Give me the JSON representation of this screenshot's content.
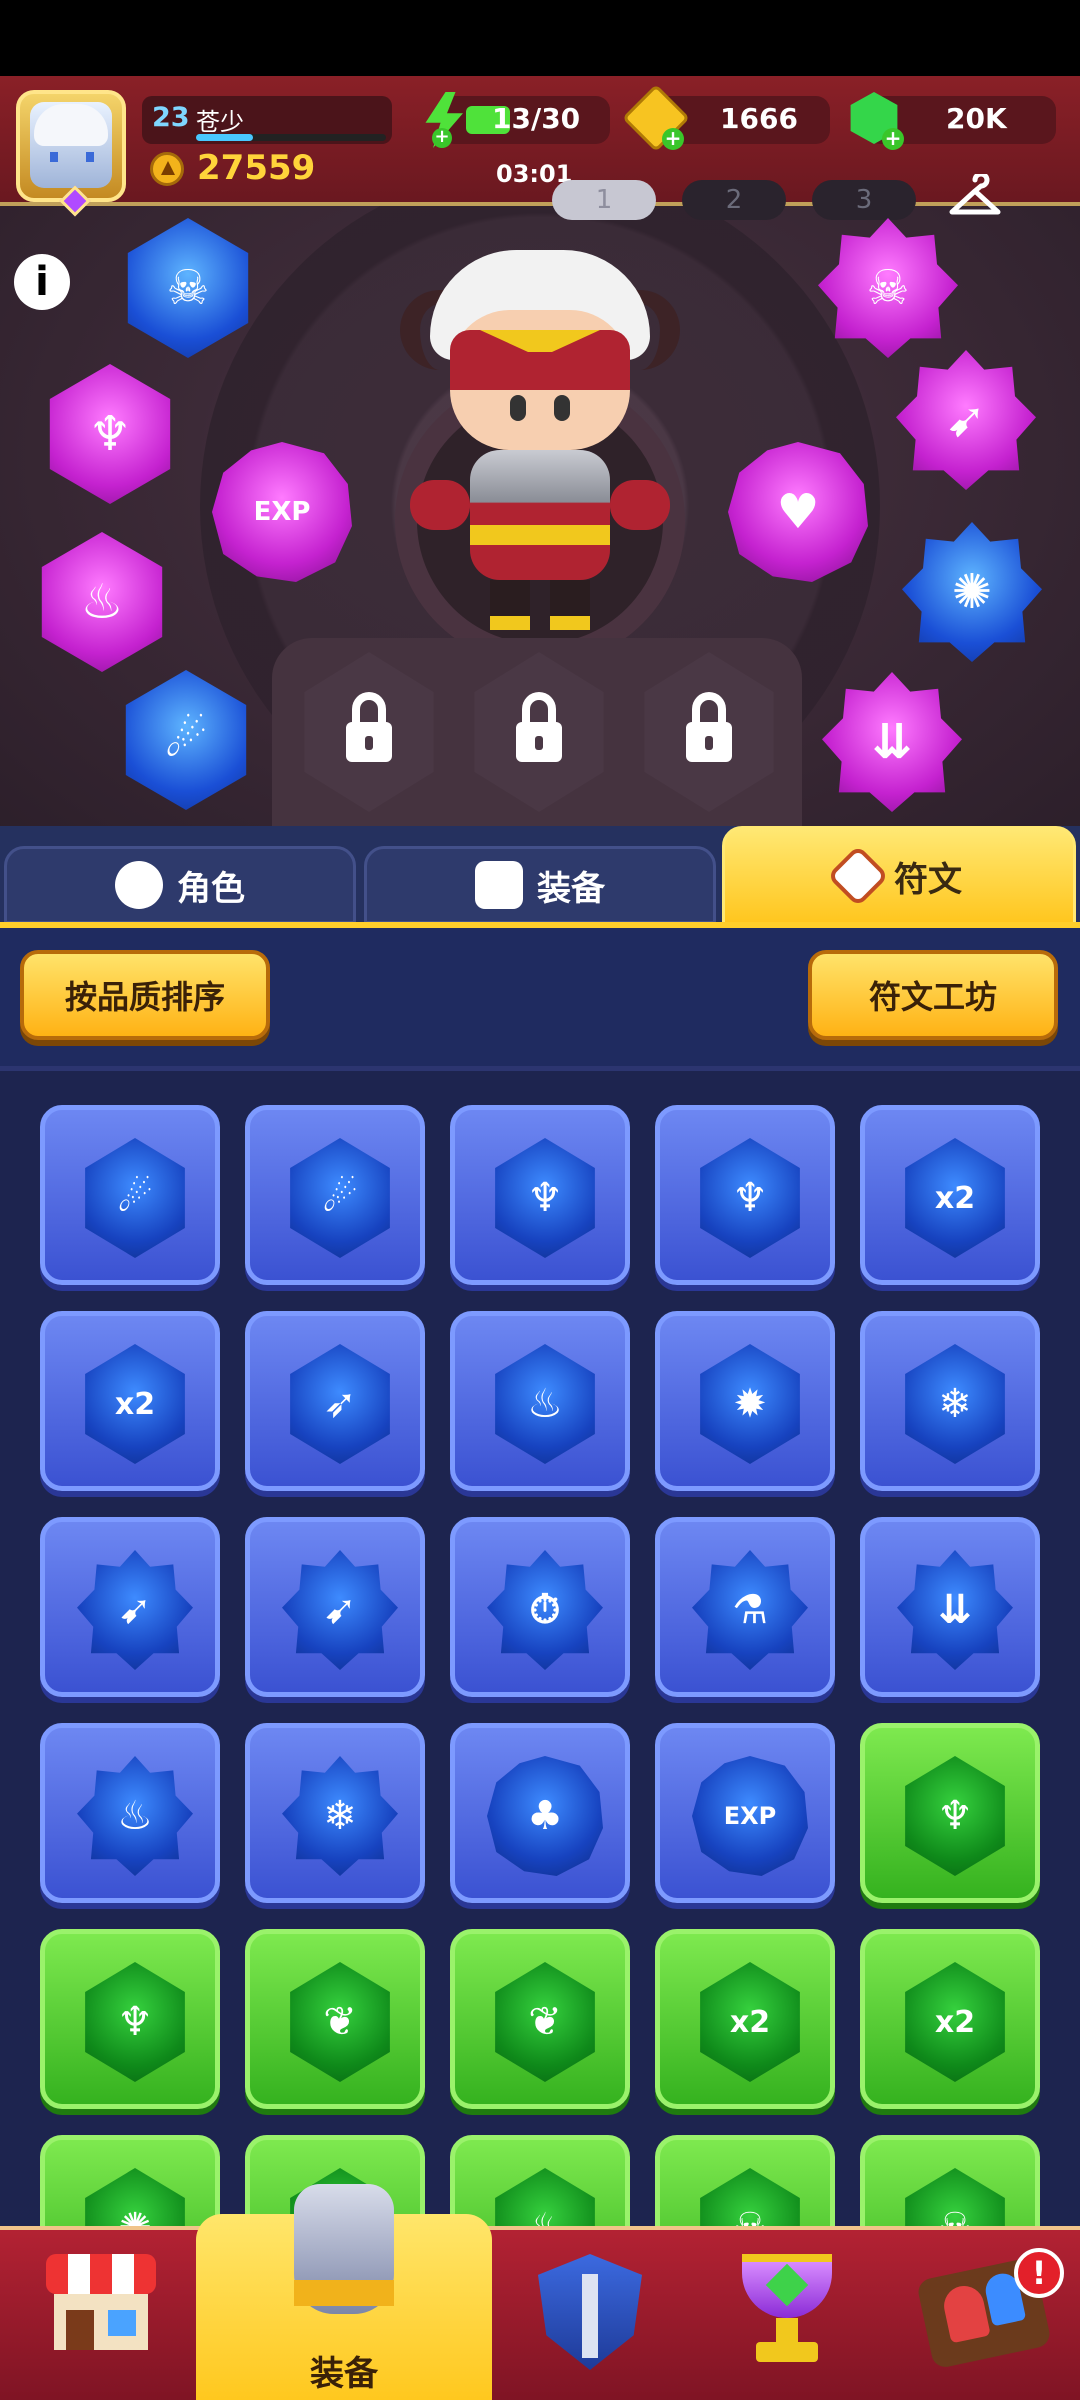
{
  "player": {
    "level": "23",
    "name": "苍少",
    "power": "27559"
  },
  "resources": {
    "energy": {
      "value": "13/30",
      "timer": "03:01"
    },
    "gold": {
      "value": "1666"
    },
    "gems": {
      "value": "20K"
    }
  },
  "presets": [
    "1",
    "2",
    "3"
  ],
  "tabs": [
    {
      "label": "角色",
      "active": false
    },
    {
      "label": "装备",
      "active": false
    },
    {
      "label": "符文",
      "active": true
    }
  ],
  "buttons": {
    "sort": "按品质排序",
    "workshop": "符文工坊"
  },
  "equipped_exp_glyph": "EXP",
  "grid_glyphs": {
    "x2": "x2",
    "exp": "EXP"
  },
  "nav": {
    "active_label": "装备",
    "badge": "!"
  },
  "colors": {
    "accent": "#ffc61e",
    "rune_blue": "#3b52d2",
    "rune_green": "#35b21f",
    "rune_purple": "#c522d0"
  }
}
